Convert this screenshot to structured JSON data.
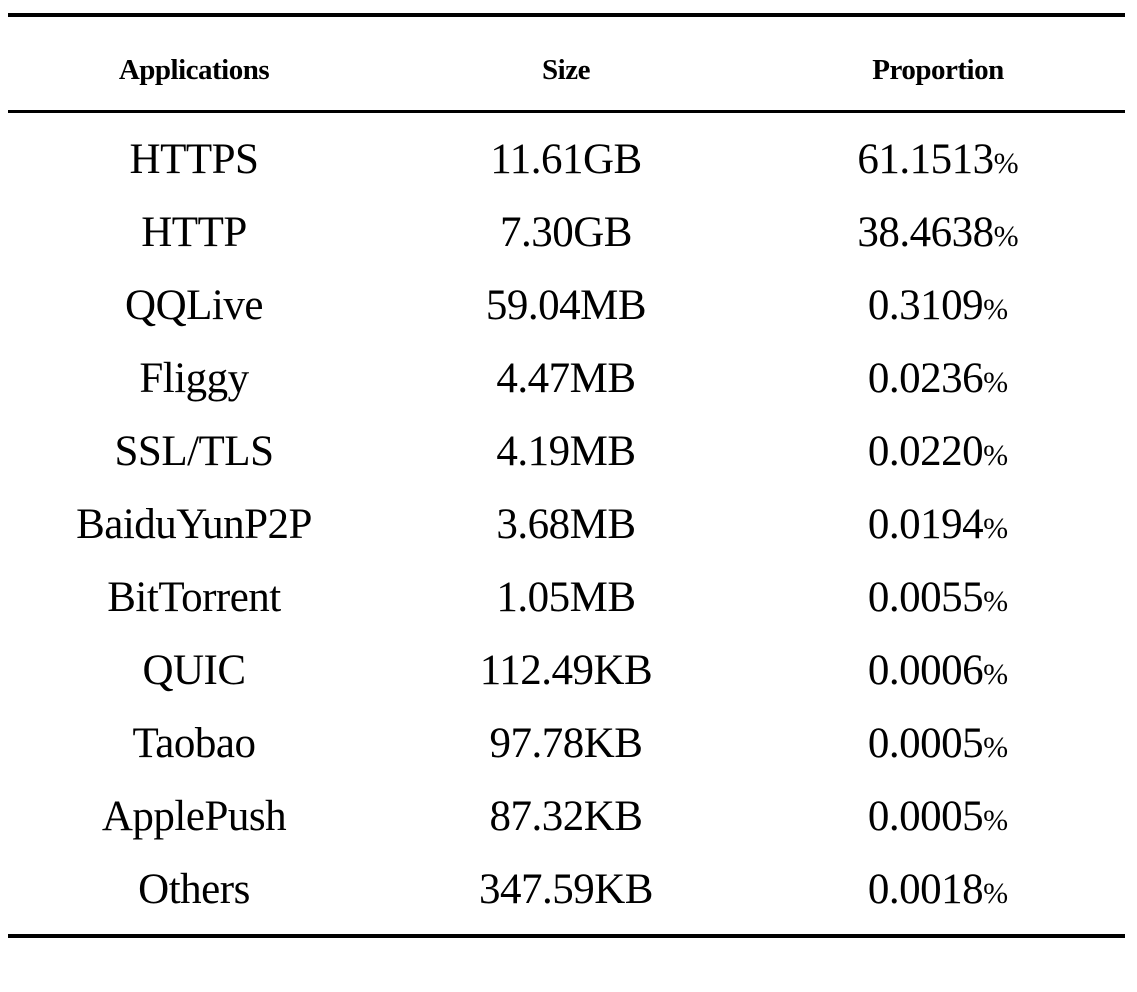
{
  "table": {
    "columns": [
      "Applications",
      "Size",
      "Proportion"
    ],
    "percent_symbol": "%",
    "rows": [
      {
        "application": "HTTPS",
        "size": "11.61GB",
        "proportion": "61.1513"
      },
      {
        "application": "HTTP",
        "size": "7.30GB",
        "proportion": "38.4638"
      },
      {
        "application": "QQLive",
        "size": "59.04MB",
        "proportion": "0.3109"
      },
      {
        "application": "Fliggy",
        "size": "4.47MB",
        "proportion": "0.0236"
      },
      {
        "application": "SSL/TLS",
        "size": "4.19MB",
        "proportion": "0.0220"
      },
      {
        "application": "BaiduYunP2P",
        "size": "3.68MB",
        "proportion": "0.0194"
      },
      {
        "application": "BitTorrent",
        "size": "1.05MB",
        "proportion": "0.0055"
      },
      {
        "application": "QUIC",
        "size": "112.49KB",
        "proportion": "0.0006"
      },
      {
        "application": "Taobao",
        "size": "97.78KB",
        "proportion": "0.0005"
      },
      {
        "application": "ApplePush",
        "size": "87.32KB",
        "proportion": "0.0005"
      },
      {
        "application": "Others",
        "size": "347.59KB",
        "proportion": "0.0018"
      }
    ]
  }
}
